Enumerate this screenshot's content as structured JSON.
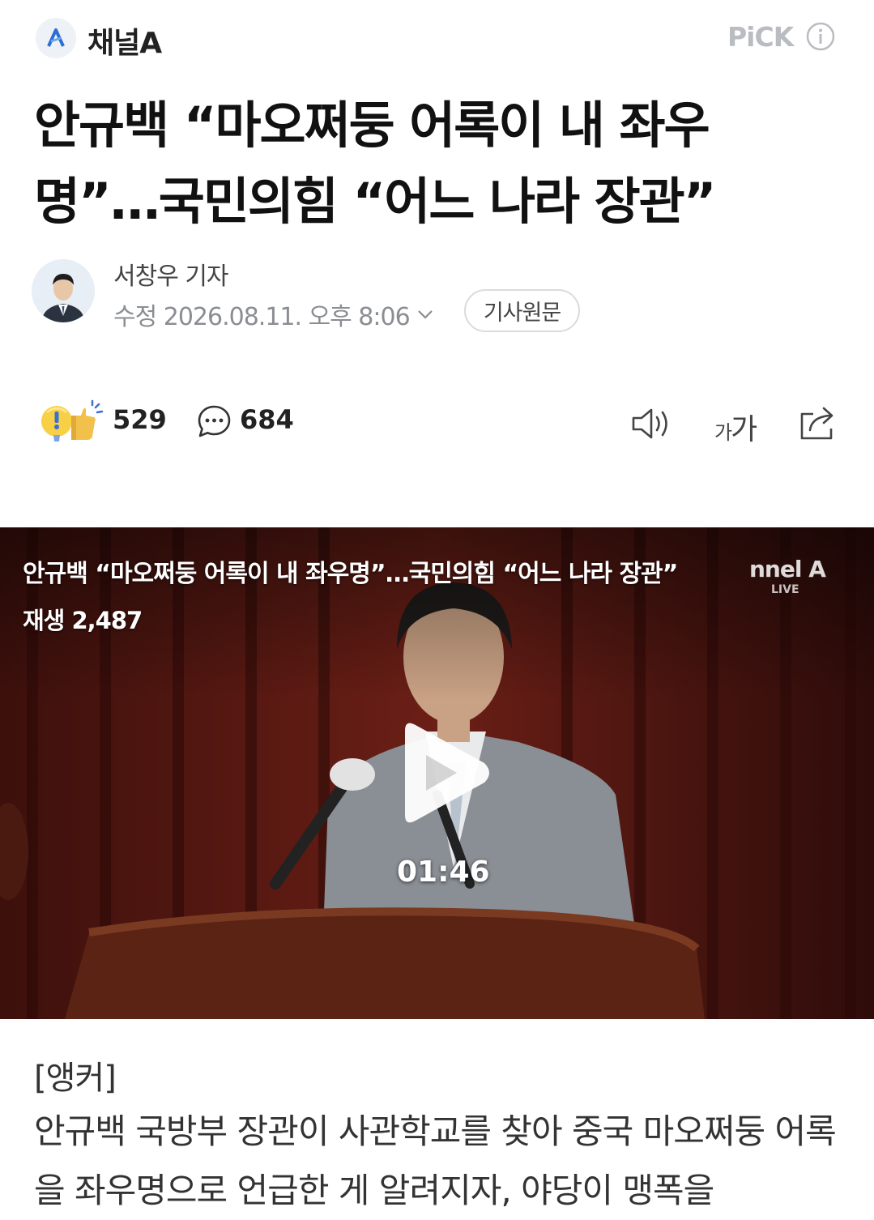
{
  "header": {
    "press_logo_letter": "A",
    "press_name": "채널A",
    "pick_label": "PiCK",
    "info_icon": "info-icon"
  },
  "article": {
    "headline_line1": "안규백 “마오쩌둥 어록이 내 좌우",
    "headline_line2": "명”…국민의힘 “어느 나라 장관”",
    "reporter": "서창우 기자",
    "datetime": "수정 2026.08.11. 오후 8:06",
    "original_button": "기사원문"
  },
  "actions": {
    "reaction_count": "529",
    "comment_count": "684",
    "tts_icon": "speaker-icon",
    "font_size_label_small": "가",
    "font_size_label_large": "가",
    "share_icon": "share-icon"
  },
  "video": {
    "title": "안규백 “마오쩌둥 어록이 내 좌우명”…국민의힘 “어느 나라 장관”",
    "plays": "재생 2,487",
    "watermark": "nnel A",
    "watermark_sub": "LIVE",
    "duration": "01:46"
  },
  "body": {
    "anchor": "[앵커]",
    "text": "안규백 국방부 장관이 사관학교를 찾아 중국 마오쩌둥 어록을 좌우명으로 언급한 게 알려지자, 야당이 맹폭을"
  },
  "colors": {
    "accent_blue": "#2b6fd6",
    "muted_gray": "#8a8d92",
    "pick_gray": "#b9bcc1"
  }
}
